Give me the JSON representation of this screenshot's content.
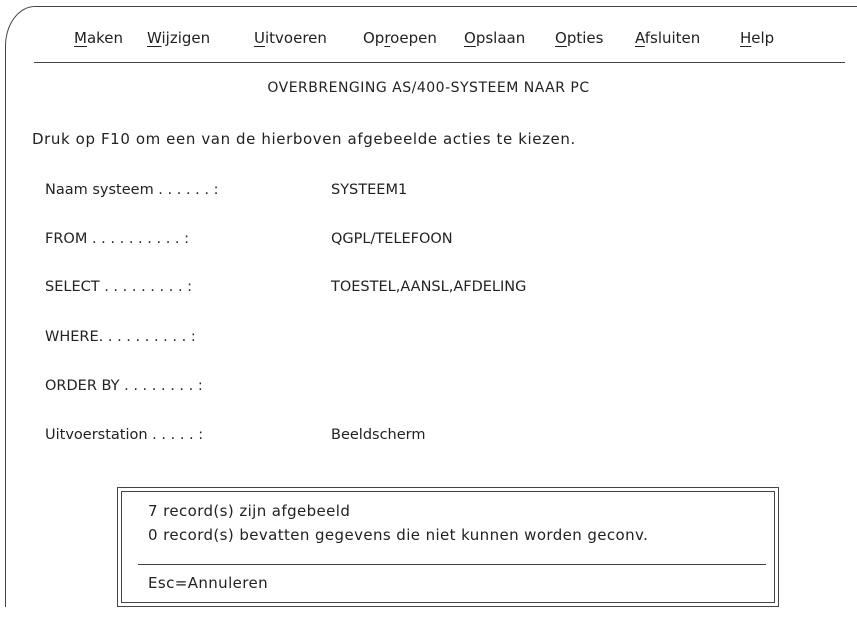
{
  "menu": {
    "items": [
      {
        "mnemonic": "M",
        "rest": "aken"
      },
      {
        "mnemonic": "W",
        "rest": "ijzigen"
      },
      {
        "mnemonic": "U",
        "rest": "itvoeren"
      },
      {
        "pre": "Op",
        "mnemonic": "r",
        "rest": "oepen"
      },
      {
        "mnemonic": "O",
        "rest": "pslaan"
      },
      {
        "mnemonic": "O",
        "rest": "pties"
      },
      {
        "mnemonic": "A",
        "rest": "fsluiten"
      },
      {
        "mnemonic": "H",
        "rest": "elp"
      }
    ]
  },
  "title": "OVERBRENGING AS/400-SYSTEEM NAAR PC",
  "instruction": "Druk op F10 om een van de hierboven afgebeelde acties te kiezen.",
  "fields": [
    {
      "label": "Naam systeem . . . . . . :",
      "value": "SYSTEEM1"
    },
    {
      "label": "FROM . . . . . . . . . . :",
      "value": "QGPL/TELEFOON"
    },
    {
      "label": "SELECT . . . . . . . . . :",
      "value": "TOESTEL,AANSL,AFDELING"
    },
    {
      "label": "WHERE. . . . . . . . . . :",
      "value": ""
    },
    {
      "label": "ORDER BY . . . . . . . . :",
      "value": ""
    },
    {
      "label": "Uitvoerstation . . . . . :",
      "value": "Beeldscherm"
    }
  ],
  "dialog": {
    "line1": "7 record(s) zijn afgebeeld",
    "line2": "0 record(s) bevatten gegevens die niet kunnen worden geconv.",
    "cancel": "Esc=Annuleren"
  }
}
